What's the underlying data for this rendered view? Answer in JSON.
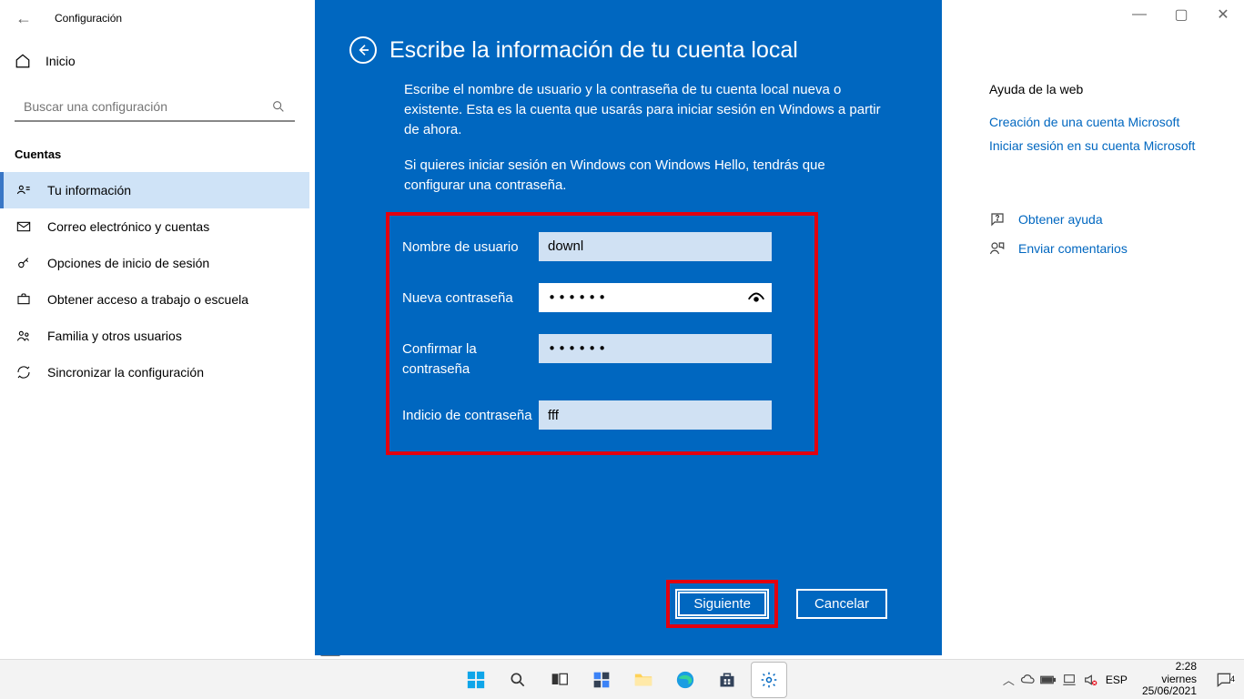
{
  "window": {
    "title": "Configuración"
  },
  "sidebar": {
    "home": "Inicio",
    "search_placeholder": "Buscar una configuración",
    "section": "Cuentas",
    "items": [
      {
        "label": "Tu información"
      },
      {
        "label": "Correo electrónico y cuentas"
      },
      {
        "label": "Opciones de inicio de sesión"
      },
      {
        "label": "Obtener acceso a trabajo o escuela"
      },
      {
        "label": "Familia y otros usuarios"
      },
      {
        "label": "Sincronizar la configuración"
      }
    ]
  },
  "rightpanel": {
    "help_title": "Ayuda de la web",
    "links": [
      "Creación de una cuenta Microsoft",
      "Iniciar sesión en su cuenta Microsoft"
    ],
    "get_help": "Obtener ayuda",
    "feedback": "Enviar comentarios"
  },
  "modal": {
    "title": "Escribe la información de tu cuenta local",
    "p1": "Escribe el nombre de usuario y la contraseña de tu cuenta local nueva o existente. Esta es la cuenta que usarás para iniciar sesión en Windows a partir de ahora.",
    "p2": "Si quieres iniciar sesión en Windows con Windows Hello, tendrás que configurar una contraseña.",
    "fields": {
      "username_label": "Nombre de usuario",
      "username_value": "downl",
      "newpass_label": "Nueva contraseña",
      "newpass_value": "••••••",
      "confirm_label": "Confirmar la contraseña",
      "confirm_value": "••••••",
      "hint_label": "Indicio de contraseña",
      "hint_value": "fff"
    },
    "next": "Siguiente",
    "cancel": "Cancelar"
  },
  "truncated": "Buscar una",
  "taskbar": {
    "lang": "ESP",
    "time": "2:28",
    "day": "viernes",
    "date": "25/06/2021",
    "notif_count": "4"
  }
}
